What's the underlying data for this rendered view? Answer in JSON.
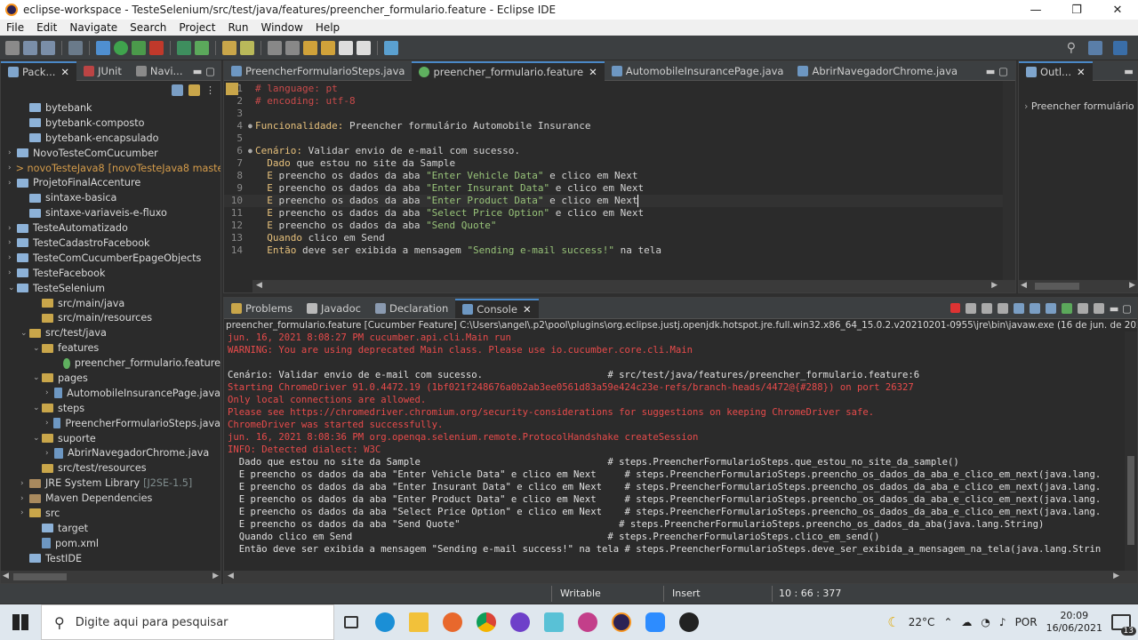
{
  "window": {
    "title": "eclipse-workspace - TesteSelenium/src/test/java/features/preencher_formulario.feature - Eclipse IDE",
    "minimize": "—",
    "restore": "❐",
    "close": "✕"
  },
  "menu": [
    "File",
    "Edit",
    "Navigate",
    "Search",
    "Project",
    "Run",
    "Window",
    "Help"
  ],
  "left_tabs": {
    "package_explorer": "Pack...",
    "junit": "JUnit",
    "navigator": "Navi..."
  },
  "tree": [
    {
      "label": "bytebank",
      "indent": 1,
      "arrow": "",
      "kind": "folder"
    },
    {
      "label": "bytebank-composto",
      "indent": 1,
      "arrow": "",
      "kind": "folder"
    },
    {
      "label": "bytebank-encapsulado",
      "indent": 1,
      "arrow": "",
      "kind": "folder"
    },
    {
      "label": "NovoTesteComCucumber",
      "indent": 0,
      "arrow": "›",
      "kind": "folder"
    },
    {
      "label": "> novoTesteJava8",
      "extra": "[novoTesteJava8 master]",
      "indent": 0,
      "arrow": "›",
      "kind": "folder",
      "style": "orange"
    },
    {
      "label": "ProjetoFinalAccenture",
      "indent": 0,
      "arrow": "›",
      "kind": "folder"
    },
    {
      "label": "sintaxe-basica",
      "indent": 1,
      "arrow": "",
      "kind": "folder"
    },
    {
      "label": "sintaxe-variaveis-e-fluxo",
      "indent": 1,
      "arrow": "",
      "kind": "folder"
    },
    {
      "label": "TesteAutomatizado",
      "indent": 0,
      "arrow": "›",
      "kind": "folder"
    },
    {
      "label": "TesteCadastroFacebook",
      "indent": 0,
      "arrow": "›",
      "kind": "folder"
    },
    {
      "label": "TesteComCucumberEpageObjects",
      "indent": 0,
      "arrow": "›",
      "kind": "folder"
    },
    {
      "label": "TesteFacebook",
      "indent": 0,
      "arrow": "›",
      "kind": "folder"
    },
    {
      "label": "TesteSelenium",
      "indent": 0,
      "arrow": "⌄",
      "kind": "folder"
    },
    {
      "label": "src/main/java",
      "indent": 2,
      "arrow": "",
      "kind": "pkg"
    },
    {
      "label": "src/main/resources",
      "indent": 2,
      "arrow": "",
      "kind": "pkg"
    },
    {
      "label": "src/test/java",
      "indent": 1,
      "arrow": "⌄",
      "kind": "pkg"
    },
    {
      "label": "features",
      "indent": 2,
      "arrow": "⌄",
      "kind": "pkg"
    },
    {
      "label": "preencher_formulario.feature",
      "indent": 4,
      "arrow": "",
      "kind": "feat"
    },
    {
      "label": "pages",
      "indent": 2,
      "arrow": "⌄",
      "kind": "pkg"
    },
    {
      "label": "AutomobileInsurancePage.java",
      "indent": 3,
      "arrow": "›",
      "kind": "file"
    },
    {
      "label": "steps",
      "indent": 2,
      "arrow": "⌄",
      "kind": "pkg"
    },
    {
      "label": "PreencherFormularioSteps.java",
      "indent": 3,
      "arrow": "›",
      "kind": "file"
    },
    {
      "label": "suporte",
      "indent": 2,
      "arrow": "⌄",
      "kind": "pkg"
    },
    {
      "label": "AbrirNavegadorChrome.java",
      "indent": 3,
      "arrow": "›",
      "kind": "file"
    },
    {
      "label": "src/test/resources",
      "indent": 2,
      "arrow": "",
      "kind": "pkg"
    },
    {
      "label": "JRE System Library",
      "extra": "[J2SE-1.5]",
      "indent": 1,
      "arrow": "›",
      "kind": "jar",
      "style": "gray"
    },
    {
      "label": "Maven Dependencies",
      "indent": 1,
      "arrow": "›",
      "kind": "jar"
    },
    {
      "label": "src",
      "indent": 1,
      "arrow": "›",
      "kind": "pkg"
    },
    {
      "label": "target",
      "indent": 2,
      "arrow": "",
      "kind": "folder"
    },
    {
      "label": "pom.xml",
      "indent": 2,
      "arrow": "",
      "kind": "file"
    },
    {
      "label": "TestIDE",
      "indent": 1,
      "arrow": "",
      "kind": "folder"
    }
  ],
  "editor_tabs": [
    {
      "label": "PreencherFormularioSteps.java",
      "active": false
    },
    {
      "label": "preencher_formulario.feature",
      "active": true
    },
    {
      "label": "AutomobileInsurancePage.java",
      "active": false
    },
    {
      "label": "AbrirNavegadorChrome.java",
      "active": false
    }
  ],
  "code": [
    {
      "n": "1",
      "parts": [
        [
          "c-comment",
          "# language: pt"
        ]
      ]
    },
    {
      "n": "2",
      "parts": [
        [
          "c-comment",
          "# encoding: utf-8"
        ]
      ]
    },
    {
      "n": "3",
      "parts": []
    },
    {
      "n": "4",
      "parts": [
        [
          "c-key",
          "Funcionalidade:"
        ],
        [
          "c-text",
          " Preencher formulário Automobile Insurance"
        ]
      ]
    },
    {
      "n": "5",
      "parts": []
    },
    {
      "n": "6",
      "parts": [
        [
          "c-key",
          "Cenário:"
        ],
        [
          "c-text",
          " Validar envio de e-mail com sucesso."
        ]
      ]
    },
    {
      "n": "7",
      "parts": [
        [
          "c-text",
          "  "
        ],
        [
          "c-key",
          "Dado"
        ],
        [
          "c-text",
          " que estou no site da Sample"
        ]
      ]
    },
    {
      "n": "8",
      "parts": [
        [
          "c-text",
          "  "
        ],
        [
          "c-key",
          "E"
        ],
        [
          "c-text",
          " preencho os dados da aba "
        ],
        [
          "c-str",
          "\"Enter Vehicle Data\""
        ],
        [
          "c-text",
          " e clico em Next"
        ]
      ]
    },
    {
      "n": "9",
      "parts": [
        [
          "c-text",
          "  "
        ],
        [
          "c-key",
          "E"
        ],
        [
          "c-text",
          " preencho os dados da aba "
        ],
        [
          "c-str",
          "\"Enter Insurant Data\""
        ],
        [
          "c-text",
          " e clico em Next"
        ]
      ]
    },
    {
      "n": "10",
      "parts": [
        [
          "c-text",
          "  "
        ],
        [
          "c-key",
          "E"
        ],
        [
          "c-text",
          " preencho os dados da aba "
        ],
        [
          "c-str",
          "\"Enter Product Data\""
        ],
        [
          "c-text",
          " e clico em Next"
        ]
      ]
    },
    {
      "n": "11",
      "parts": [
        [
          "c-text",
          "  "
        ],
        [
          "c-key",
          "E"
        ],
        [
          "c-text",
          " preencho os dados da aba "
        ],
        [
          "c-str",
          "\"Select Price Option\""
        ],
        [
          "c-text",
          " e clico em Next"
        ]
      ]
    },
    {
      "n": "12",
      "parts": [
        [
          "c-text",
          "  "
        ],
        [
          "c-key",
          "E"
        ],
        [
          "c-text",
          " preencho os dados da aba "
        ],
        [
          "c-str",
          "\"Send Quote\""
        ]
      ]
    },
    {
      "n": "13",
      "parts": [
        [
          "c-text",
          "  "
        ],
        [
          "c-key",
          "Quando"
        ],
        [
          "c-text",
          " clico em Send"
        ]
      ]
    },
    {
      "n": "14",
      "parts": [
        [
          "c-text",
          "  "
        ],
        [
          "c-key",
          "Então"
        ],
        [
          "c-text",
          " deve ser exibida a mensagem "
        ],
        [
          "c-str",
          "\"Sending e-mail success!\""
        ],
        [
          "c-text",
          " na tela"
        ]
      ]
    }
  ],
  "outline": {
    "tab": "Outl...",
    "item": "Preencher formulário A"
  },
  "bottom_tabs": [
    {
      "label": "Problems",
      "active": false
    },
    {
      "label": "Javadoc",
      "active": false
    },
    {
      "label": "Declaration",
      "active": false
    },
    {
      "label": "Console",
      "active": true
    }
  ],
  "console_header": "preencher_formulario.feature [Cucumber Feature] C:\\Users\\angel\\.p2\\pool\\plugins\\org.eclipse.justj.openjdk.hotspot.jre.full.win32.x86_64_15.0.2.v20210201-0955\\jre\\bin\\javaw.exe  (16 de jun. de 2021 20:08:22)",
  "console": [
    {
      "c": "red",
      "t": "jun. 16, 2021 8:08:27 PM cucumber.api.cli.Main run"
    },
    {
      "c": "red",
      "t": "WARNING: You are using deprecated Main class. Please use io.cucumber.core.cli.Main"
    },
    {
      "c": "",
      "t": ""
    },
    {
      "c": "",
      "t": "Cenário: Validar envio de e-mail com sucesso.                      # src/test/java/features/preencher_formulario.feature:6"
    },
    {
      "c": "red",
      "t": "Starting ChromeDriver 91.0.4472.19 (1bf021f248676a0b2ab3ee0561d83a59e424c23e-refs/branch-heads/4472@{#288}) on port 26327"
    },
    {
      "c": "red",
      "t": "Only local connections are allowed."
    },
    {
      "c": "red",
      "t": "Please see https://chromedriver.chromium.org/security-considerations for suggestions on keeping ChromeDriver safe."
    },
    {
      "c": "red",
      "t": "ChromeDriver was started successfully."
    },
    {
      "c": "red",
      "t": "jun. 16, 2021 8:08:36 PM org.openqa.selenium.remote.ProtocolHandshake createSession"
    },
    {
      "c": "red",
      "t": "INFO: Detected dialect: W3C"
    },
    {
      "c": "",
      "t": "  Dado que estou no site da Sample                                 # steps.PreencherFormularioSteps.que_estou_no_site_da_sample()"
    },
    {
      "c": "",
      "t": "  E preencho os dados da aba \"Enter Vehicle Data\" e clico em Next     # steps.PreencherFormularioSteps.preencho_os_dados_da_aba_e_clico_em_next(java.lang."
    },
    {
      "c": "",
      "t": "  E preencho os dados da aba \"Enter Insurant Data\" e clico em Next    # steps.PreencherFormularioSteps.preencho_os_dados_da_aba_e_clico_em_next(java.lang."
    },
    {
      "c": "",
      "t": "  E preencho os dados da aba \"Enter Product Data\" e clico em Next     # steps.PreencherFormularioSteps.preencho_os_dados_da_aba_e_clico_em_next(java.lang."
    },
    {
      "c": "",
      "t": "  E preencho os dados da aba \"Select Price Option\" e clico em Next    # steps.PreencherFormularioSteps.preencho_os_dados_da_aba_e_clico_em_next(java.lang."
    },
    {
      "c": "",
      "t": "  E preencho os dados da aba \"Send Quote\"                            # steps.PreencherFormularioSteps.preencho_os_dados_da_aba(java.lang.String)"
    },
    {
      "c": "",
      "t": "  Quando clico em Send                                             # steps.PreencherFormularioSteps.clico_em_send()"
    },
    {
      "c": "",
      "t": "  Então deve ser exibida a mensagem \"Sending e-mail success!\" na tela # steps.PreencherFormularioSteps.deve_ser_exibida_a_mensagem_na_tela(java.lang.Strin"
    }
  ],
  "status": {
    "writable": "Writable",
    "insert": "Insert",
    "position": "10 : 66 : 377"
  },
  "taskbar": {
    "search_placeholder": "Digite aqui para pesquisar",
    "weather": "22°C",
    "lang": "POR",
    "time": "20:09",
    "date": "16/06/2021",
    "notifications": "13"
  },
  "colors": {
    "accent": "#4a88c7",
    "comment": "#c94a4a",
    "keyword": "#e6c07b",
    "string": "#98c379"
  }
}
